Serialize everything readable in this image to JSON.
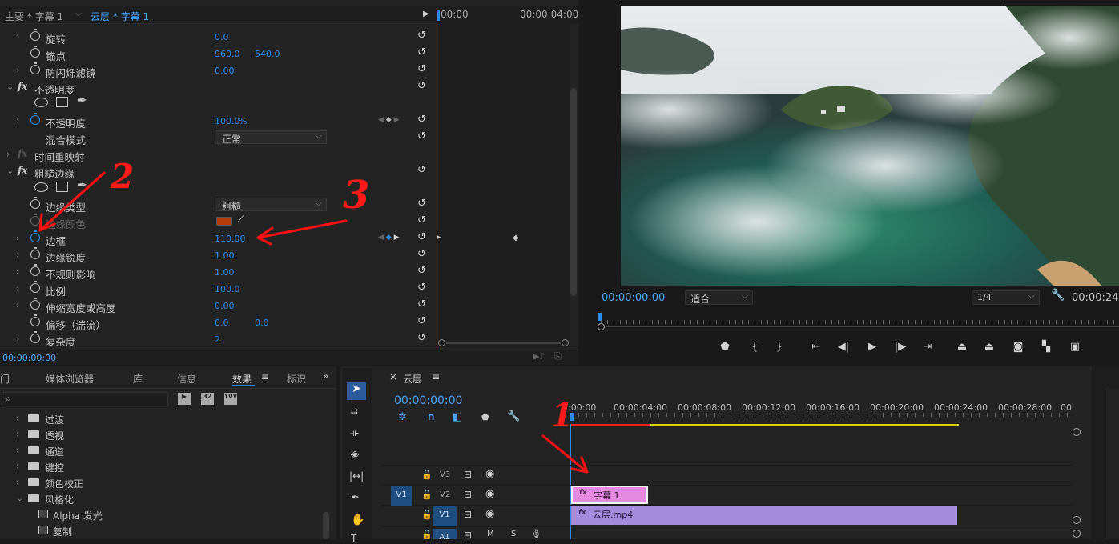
{
  "effect_controls": {
    "tab_main": "主要 * 字幕 1",
    "tab_active": "云层 * 字幕 1",
    "tl_start": "00:00",
    "tl_end": "00:00:04:00",
    "footer_time": "00:00:00:00",
    "rows": [
      {
        "name": "旋转",
        "v1": "0.0"
      },
      {
        "name": "锚点",
        "v1": "960.0",
        "v2": "540.0"
      },
      {
        "name": "防闪烁滤镜",
        "v1": "0.00"
      }
    ],
    "opacity_section": "不透明度",
    "opacity_name": "不透明度",
    "opacity_value": "100.0",
    "opacity_unit": "%",
    "blend_label": "混合模式",
    "blend_value": "正常",
    "time_remap": "时间重映射",
    "rough_section": "粗糙边缘",
    "edge_type_label": "边缘类型",
    "edge_type_value": "粗糙",
    "edge_color_label": "边缘颜色",
    "edge_color": "#b33c0a",
    "border_label": "边框",
    "border_value": "110.00",
    "rows2": [
      {
        "name": "边缘锐度",
        "v1": "1.00"
      },
      {
        "name": "不规则影响",
        "v1": "1.00"
      },
      {
        "name": "比例",
        "v1": "100.0"
      },
      {
        "name": "伸缩宽度或高度",
        "v1": "0.00"
      },
      {
        "name": "偏移（湍流）",
        "v1": "0.0",
        "v2": "0.0"
      },
      {
        "name": "复杂度",
        "v1": "2"
      }
    ]
  },
  "program": {
    "timecode": "00:00:00:00",
    "fit": "适合",
    "resolution": "1/4",
    "end_time": "00:00:24:"
  },
  "project": {
    "tabs": [
      "门",
      "媒体浏览器",
      "库",
      "信息",
      "效果",
      "标识"
    ],
    "active_tab": "效果",
    "bin_icons": [
      "32",
      "32",
      "YUV"
    ],
    "tree": [
      {
        "label": "过渡",
        "folder": true,
        "open": false
      },
      {
        "label": "透视",
        "folder": true,
        "open": false
      },
      {
        "label": "通道",
        "folder": true,
        "open": false
      },
      {
        "label": "键控",
        "folder": true,
        "open": false
      },
      {
        "label": "颜色校正",
        "folder": true,
        "open": false
      },
      {
        "label": "风格化",
        "folder": true,
        "open": true
      },
      {
        "label": "Alpha 发光",
        "folder": false
      },
      {
        "label": "复制",
        "folder": false
      }
    ]
  },
  "timeline": {
    "seq_name": "云层",
    "timecode": "00:00:00:00",
    "ruler": [
      ":00:00",
      "00:00:04:00",
      "00:00:08:00",
      "00:00:12:00",
      "00:00:16:00",
      "00:00:20:00",
      "00:00:24:00",
      "00:00:28:00",
      "00:"
    ],
    "tracks": [
      {
        "name": "V3",
        "src": ""
      },
      {
        "name": "V2",
        "src": "V1"
      },
      {
        "name": "V1",
        "src": ""
      },
      {
        "name": "A1",
        "src": ""
      }
    ],
    "clips": [
      {
        "name": "字幕 1",
        "track": "V2"
      },
      {
        "name": "云层.mp4",
        "track": "V1"
      }
    ]
  },
  "annotations": {
    "a1": "1",
    "a2": "2",
    "a3": "3"
  }
}
